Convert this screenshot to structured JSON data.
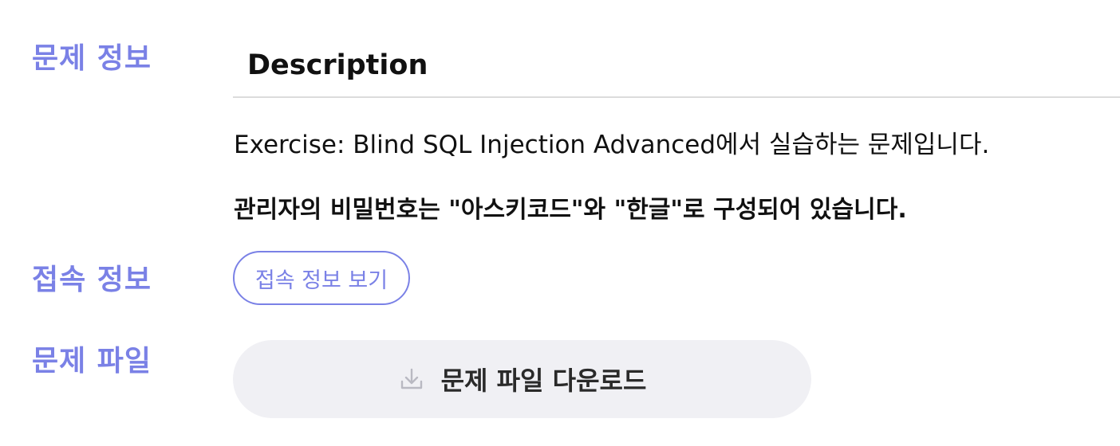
{
  "sections": {
    "info_label": "문제 정보",
    "connection_label": "접속 정보",
    "file_label": "문제 파일"
  },
  "description": {
    "heading": "Description",
    "line1": "Exercise: Blind SQL Injection Advanced에서 실습하는 문제입니다.",
    "line2": "관리자의 비밀번호는 \"아스키코드\"와 \"한글\"로 구성되어 있습니다."
  },
  "connection": {
    "button_label": "접속 정보 보기"
  },
  "file": {
    "download_label": "문제 파일 다운로드",
    "icon": "download-icon"
  },
  "colors": {
    "accent": "#7a81e6",
    "download_bg": "#f0f0f4",
    "text": "#111111",
    "divider": "#dcdcdc"
  }
}
